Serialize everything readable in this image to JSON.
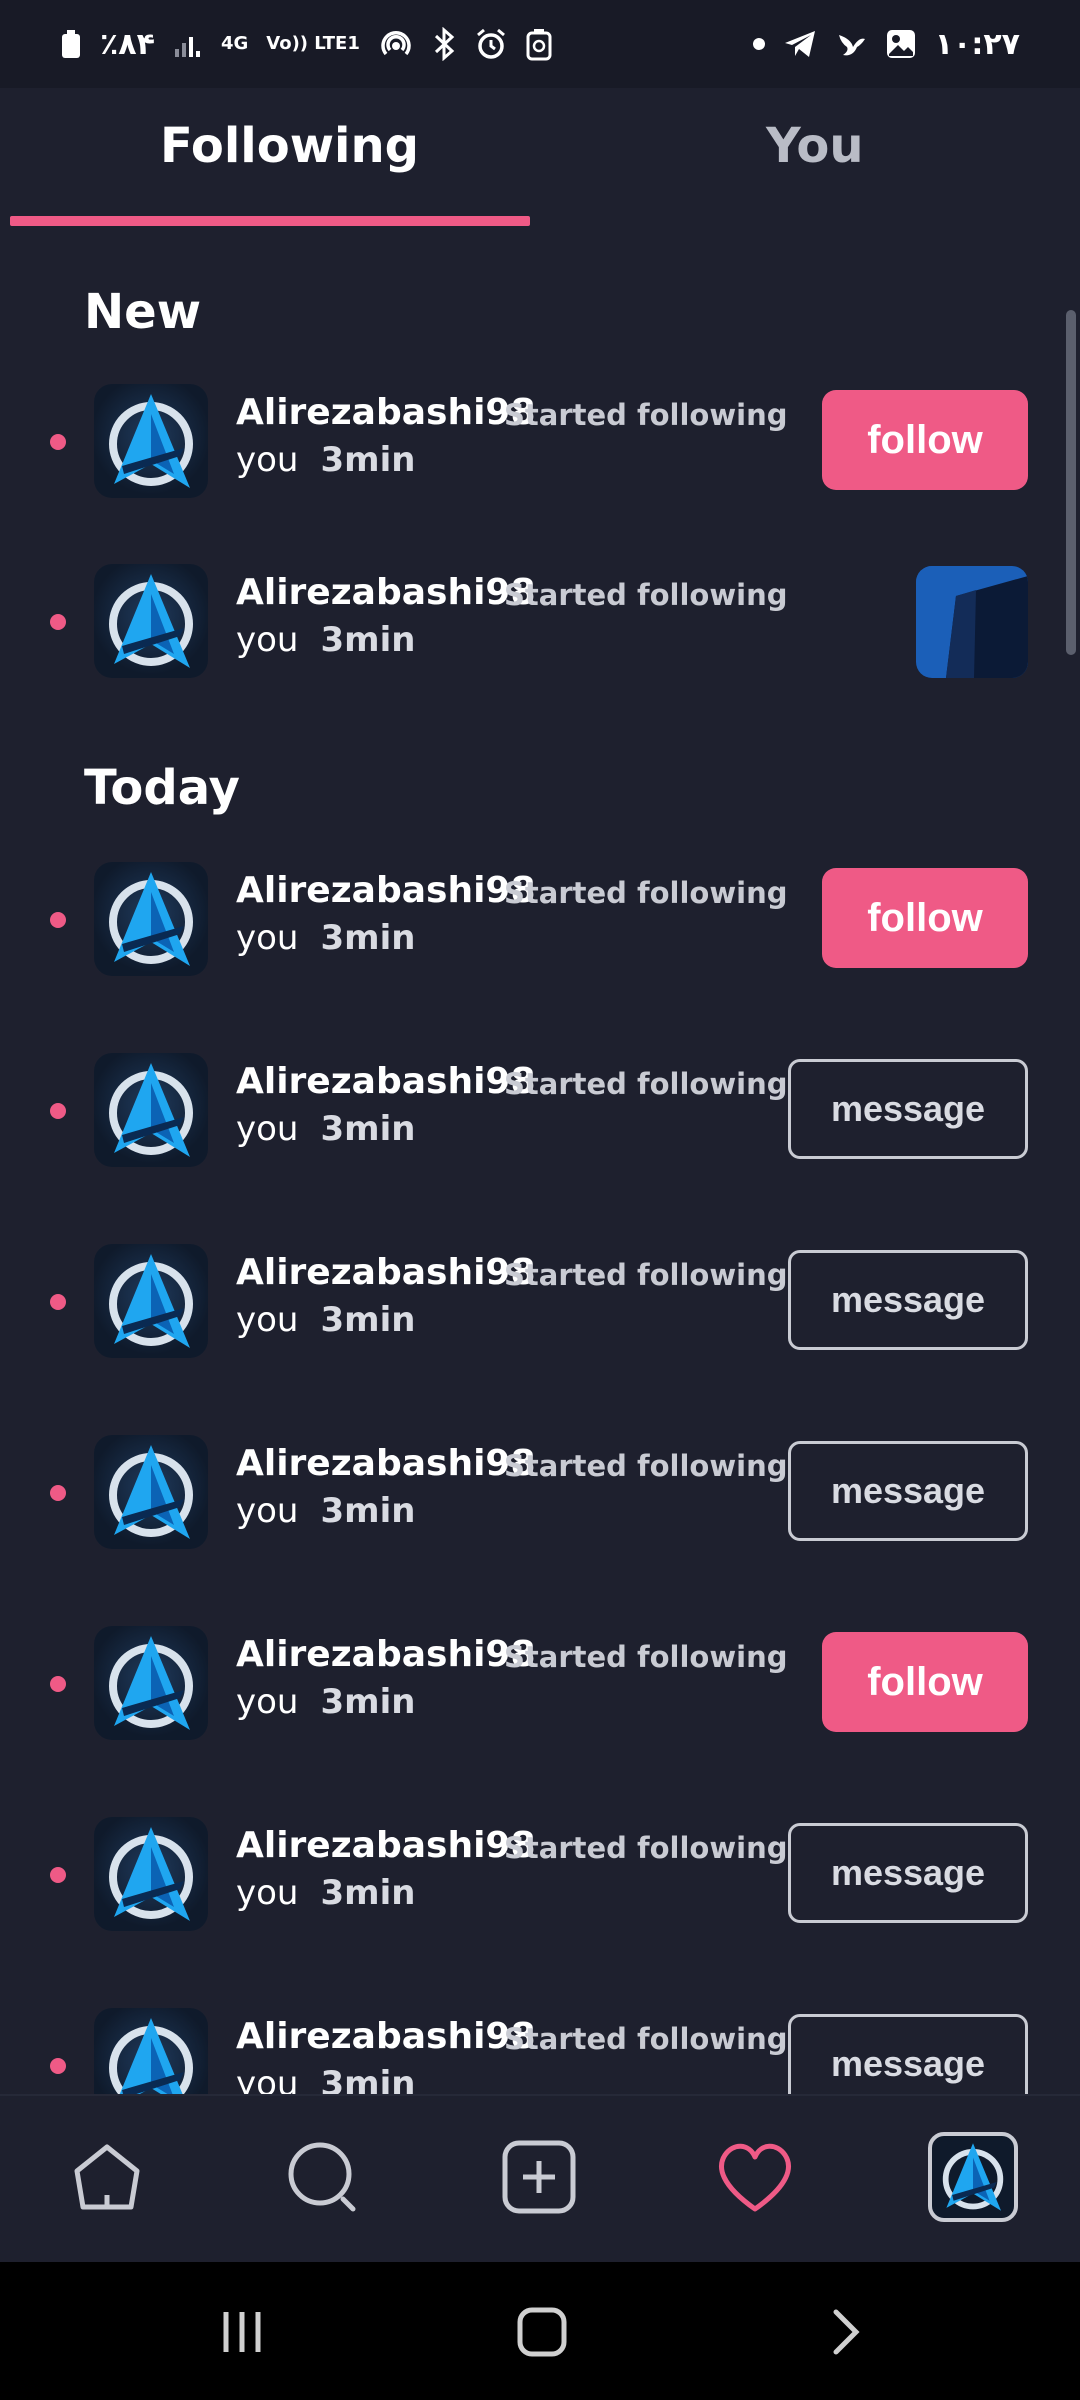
{
  "status_bar": {
    "battery": "٪۸۴",
    "network": "4G",
    "volte": "Vo)) LTE1",
    "time": "۱۰:۲۷"
  },
  "tabs": [
    {
      "label": "Following",
      "active": true
    },
    {
      "label": "You",
      "active": false
    }
  ],
  "sections": {
    "new": "New",
    "today": "Today"
  },
  "notifications": [
    {
      "user": "Alirezabashi98",
      "action": "Started following",
      "object": "you",
      "time": "3min",
      "button": "follow"
    },
    {
      "user": "Alirezabashi98",
      "action": "Started following",
      "object": "you",
      "time": "3min",
      "button": "thumbnail"
    },
    {
      "user": "Alirezabashi98",
      "action": "Started following",
      "object": "you",
      "time": "3min",
      "button": "follow"
    },
    {
      "user": "Alirezabashi98",
      "action": "Started following",
      "object": "you",
      "time": "3min",
      "button": "message"
    },
    {
      "user": "Alirezabashi98",
      "action": "Started following",
      "object": "you",
      "time": "3min",
      "button": "message"
    },
    {
      "user": "Alirezabashi98",
      "action": "Started following",
      "object": "you",
      "time": "3min",
      "button": "message"
    },
    {
      "user": "Alirezabashi98",
      "action": "Started following",
      "object": "you",
      "time": "3min",
      "button": "follow"
    },
    {
      "user": "Alirezabashi98",
      "action": "Started following",
      "object": "you",
      "time": "3min",
      "button": "message"
    },
    {
      "user": "Alirezabashi98",
      "action": "Started following",
      "object": "you",
      "time": "3min",
      "button": "message"
    }
  ],
  "labels": {
    "follow": "follow",
    "message": "message"
  },
  "bottom_nav": [
    "home-icon",
    "search-icon",
    "add-post-icon",
    "heart-icon",
    "profile-avatar"
  ],
  "colors": {
    "accent": "#ef5a86",
    "background": "#1e202e"
  }
}
